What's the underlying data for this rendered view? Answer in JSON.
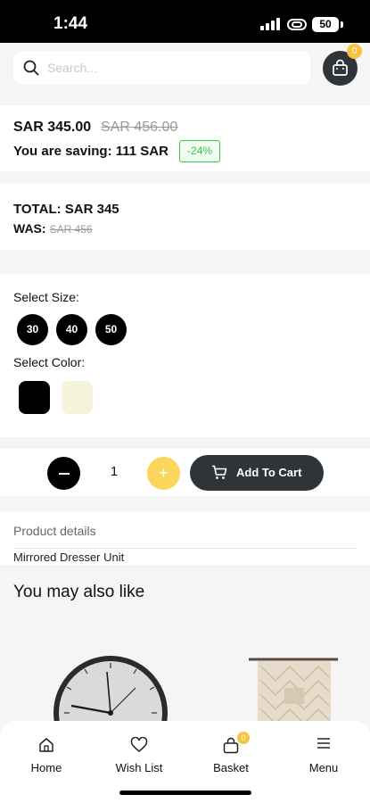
{
  "status_bar": {
    "time": "1:44",
    "battery": "50"
  },
  "header": {
    "search_placeholder": "Search...",
    "cart_count": "0"
  },
  "price": {
    "current": "SAR 345.00",
    "original": "SAR 456.00",
    "saving_text": "You are saving: 111 SAR",
    "discount": "-24%"
  },
  "totals": {
    "total_label": "TOTAL: SAR 345",
    "was_label": "WAS:",
    "was_value": "SAR 456"
  },
  "options": {
    "size_label": "Select Size:",
    "sizes": [
      "30",
      "40",
      "50"
    ],
    "color_label": "Select Color:",
    "colors": [
      "#000000",
      "#f6f3dc"
    ]
  },
  "cart": {
    "quantity": "1",
    "plus": "+",
    "add_to_cart": "Add To Cart"
  },
  "details": {
    "title": "Product details",
    "text": "Mirrored Dresser Unit"
  },
  "recommendations": {
    "title": "You may also like"
  },
  "bottom_nav": {
    "items": [
      {
        "label": "Home",
        "icon": "home-icon"
      },
      {
        "label": "Wish List",
        "icon": "heart-icon"
      },
      {
        "label": "Basket",
        "icon": "basket-icon"
      },
      {
        "label": "Menu",
        "icon": "menu-icon"
      }
    ],
    "basket_count": "0"
  }
}
